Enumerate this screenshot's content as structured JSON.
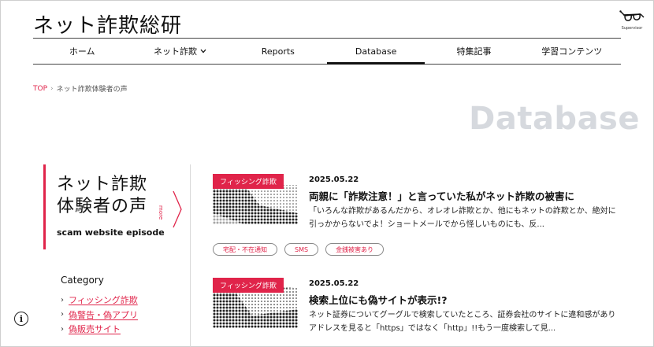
{
  "site": {
    "logo": "ネット詐欺総研",
    "supervisor_label": "Supervisor"
  },
  "nav": {
    "items": [
      {
        "label": "ホーム"
      },
      {
        "label": "ネット詐欺"
      },
      {
        "label": "Reports"
      },
      {
        "label": "Database"
      },
      {
        "label": "特集記事"
      },
      {
        "label": "学習コンテンツ"
      }
    ],
    "active": "Database"
  },
  "breadcrumb": {
    "top": "TOP",
    "current": "ネット詐欺体験者の声"
  },
  "page_title": "Database",
  "side": {
    "title_line1": "ネット詐欺",
    "title_line2": "体験者の声",
    "subtitle": "scam website episode",
    "more": "more",
    "category_title": "Category",
    "categories": [
      {
        "label": "フィッシング詐欺"
      },
      {
        "label": "偽警告・偽アプリ"
      },
      {
        "label": "偽販売サイト"
      }
    ]
  },
  "articles": [
    {
      "tag": "フィッシング詐欺",
      "date": "2025.05.22",
      "title": "両親に「詐欺注意！」と言っていた私がネット詐欺の被害に",
      "excerpt": "「いろんな詐欺があるんだから、オレオレ詐欺とか、他にもネットの詐欺とか、絶対に引っかからないでよ！ショートメールでから怪しいものにも、反...",
      "tags": [
        "宅配・不在通知",
        "SMS",
        "金銭被害あり"
      ]
    },
    {
      "tag": "フィッシング詐欺",
      "date": "2025.05.22",
      "title": "検索上位にも偽サイトが表示!?",
      "excerpt": "ネット証券についてグーグルで検索していたところ、証券会社のサイトに違和感がありアドレスを見ると「https」ではなく「http」!!もう一度検索して見...",
      "tags": []
    }
  ],
  "colors": {
    "accent": "#e0244a",
    "title_gray": "#d6d9de"
  },
  "icons": {
    "supervisor": "glasses-icon",
    "info": "info-icon"
  }
}
